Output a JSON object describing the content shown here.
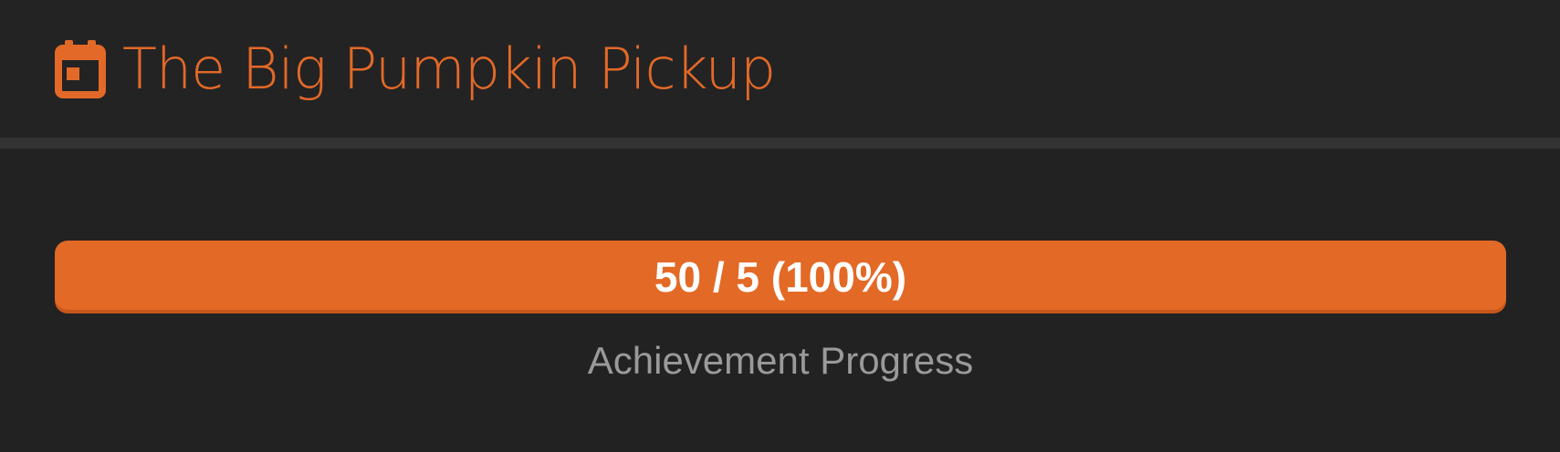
{
  "header": {
    "icon": "calendar-icon",
    "title": "The Big Pumpkin Pickup"
  },
  "progress": {
    "text": "50 / 5 (100%)",
    "fraction": 1.0,
    "caption": "Achievement Progress"
  },
  "colors": {
    "accent": "#e36926",
    "background": "#222222",
    "divider": "#333333",
    "caption": "#9a9a9a"
  }
}
